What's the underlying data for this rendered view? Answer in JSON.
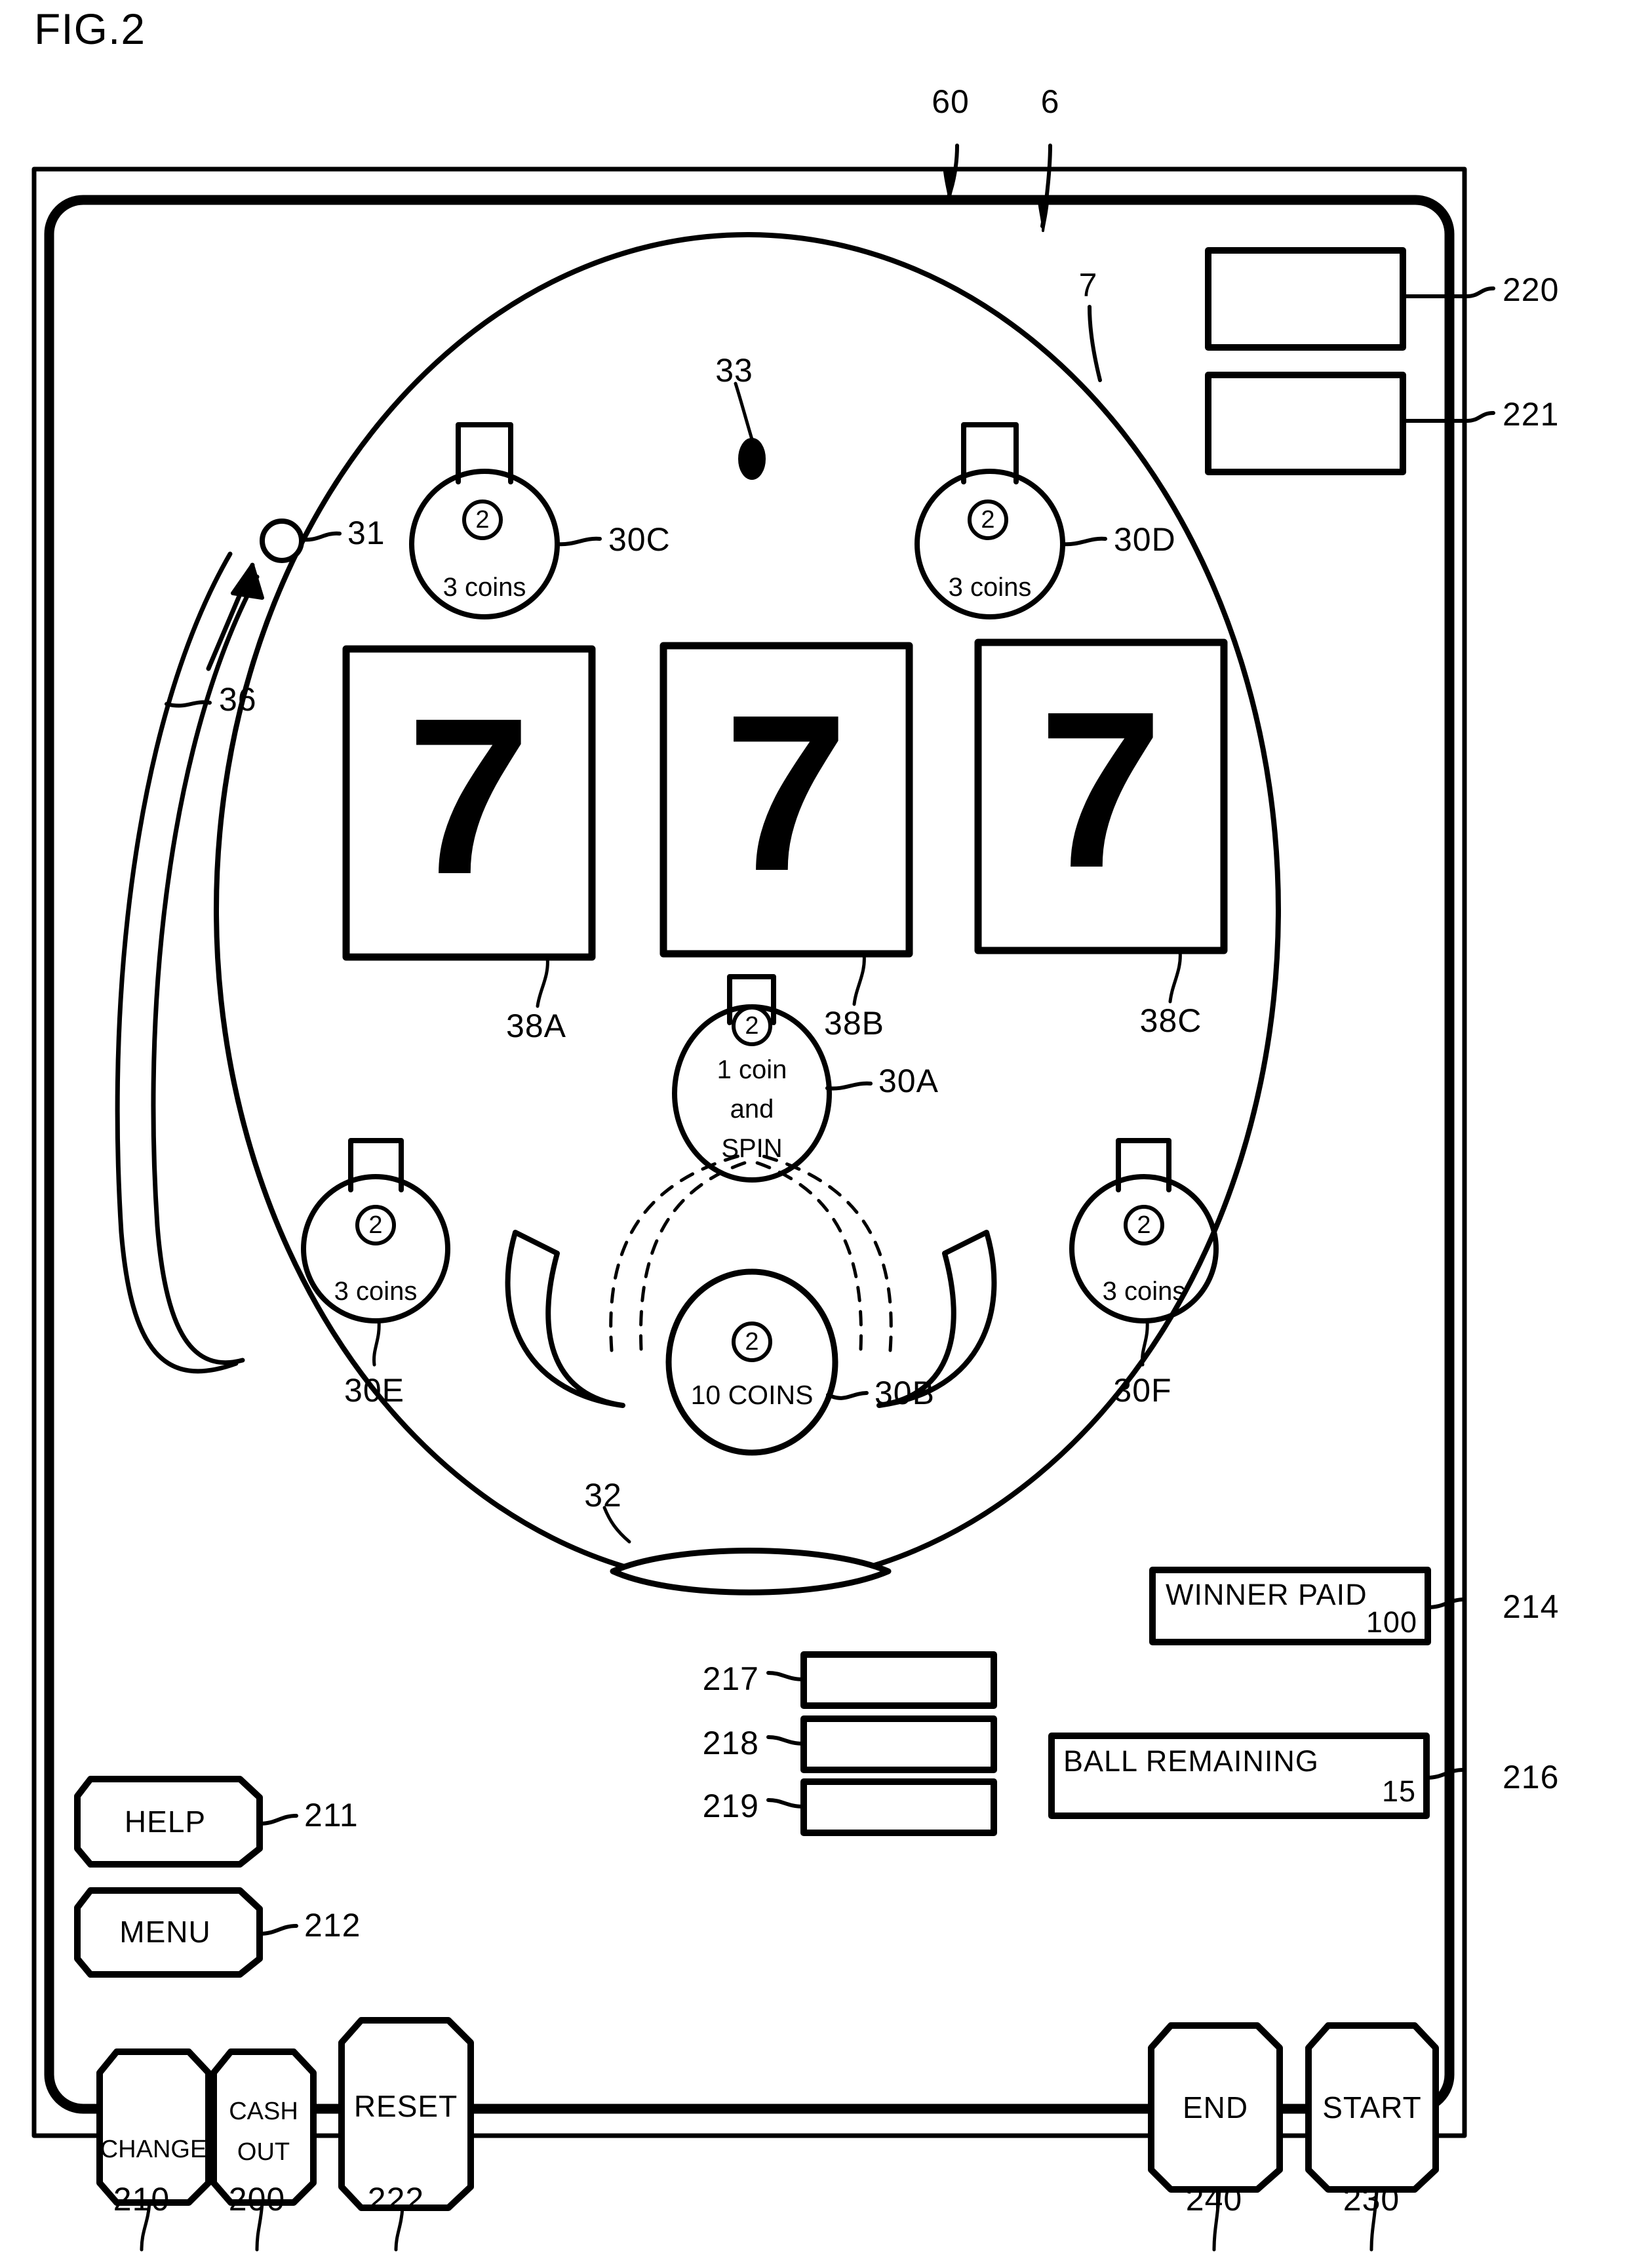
{
  "figure": {
    "label": "FIG.2",
    "domain_note": "patent line drawing of a slot-machine / pachinko hybrid game display"
  },
  "reference_numerals": {
    "outer_cabinet": "60",
    "inner_panel": "6",
    "playfield_area": "7",
    "launched_ball_path_start": "31",
    "guide_rail": "36",
    "free_ball": "33",
    "out_hole": "32",
    "reel_window_left": "38A",
    "reel_window_center": "38B",
    "reel_window_right": "38C",
    "pocket_center_spin": "30A",
    "pocket_bottom_10coins": "30B",
    "pocket_upper_left": "30C",
    "pocket_upper_right": "30D",
    "pocket_lower_left": "30E",
    "pocket_lower_right": "30F",
    "display_220": "220",
    "display_221": "221",
    "winner_paid_display": "214",
    "ball_remaining_display": "216",
    "blank_box_217": "217",
    "blank_box_218": "218",
    "blank_box_219": "219",
    "help_button": "211",
    "menu_button": "212",
    "change_button": "210",
    "cash_out_button": "200",
    "reset_button": "222",
    "end_button": "240",
    "start_button": "230"
  },
  "reels": {
    "symbols": [
      "7",
      "7",
      "7"
    ],
    "labels": [
      "38A",
      "38B",
      "38C"
    ]
  },
  "pockets": [
    {
      "id": "30C",
      "badge": "2",
      "line1": "3 coins",
      "line2": "",
      "line3": ""
    },
    {
      "id": "30D",
      "badge": "2",
      "line1": "3 coins",
      "line2": "",
      "line3": ""
    },
    {
      "id": "30A",
      "badge": "2",
      "line1": "1 coin",
      "line2": "and",
      "line3": "SPIN"
    },
    {
      "id": "30E",
      "badge": "2",
      "line1": "3 coins",
      "line2": "",
      "line3": ""
    },
    {
      "id": "30F",
      "badge": "2",
      "line1": "3 coins",
      "line2": "",
      "line3": ""
    },
    {
      "id": "30B",
      "badge": "2",
      "line1": "10 COINS",
      "line2": "",
      "line3": ""
    }
  ],
  "displays": {
    "winner_paid": {
      "title": "WINNER  PAID",
      "value": "100",
      "ref": "214"
    },
    "ball_remaining": {
      "title": "BALL   REMAINING",
      "value": "15",
      "ref": "216"
    },
    "blank_boxes": [
      {
        "ref": "217"
      },
      {
        "ref": "218"
      },
      {
        "ref": "219"
      }
    ],
    "top_right_boxes": [
      {
        "ref": "220"
      },
      {
        "ref": "221"
      }
    ]
  },
  "buttons": {
    "help": {
      "label": "HELP",
      "ref": "211"
    },
    "menu": {
      "label": "MENU",
      "ref": "212"
    },
    "change": {
      "label": "CHANGE",
      "ref": "210"
    },
    "cash_out": {
      "label_line1": "CASH",
      "label_line2": "OUT",
      "ref": "200"
    },
    "reset": {
      "label": "RESET",
      "ref": "222"
    },
    "end": {
      "label": "END",
      "ref": "240"
    },
    "start": {
      "label": "START",
      "ref": "230"
    }
  },
  "colors": {
    "ink": "#000000",
    "paper": "#ffffff"
  }
}
